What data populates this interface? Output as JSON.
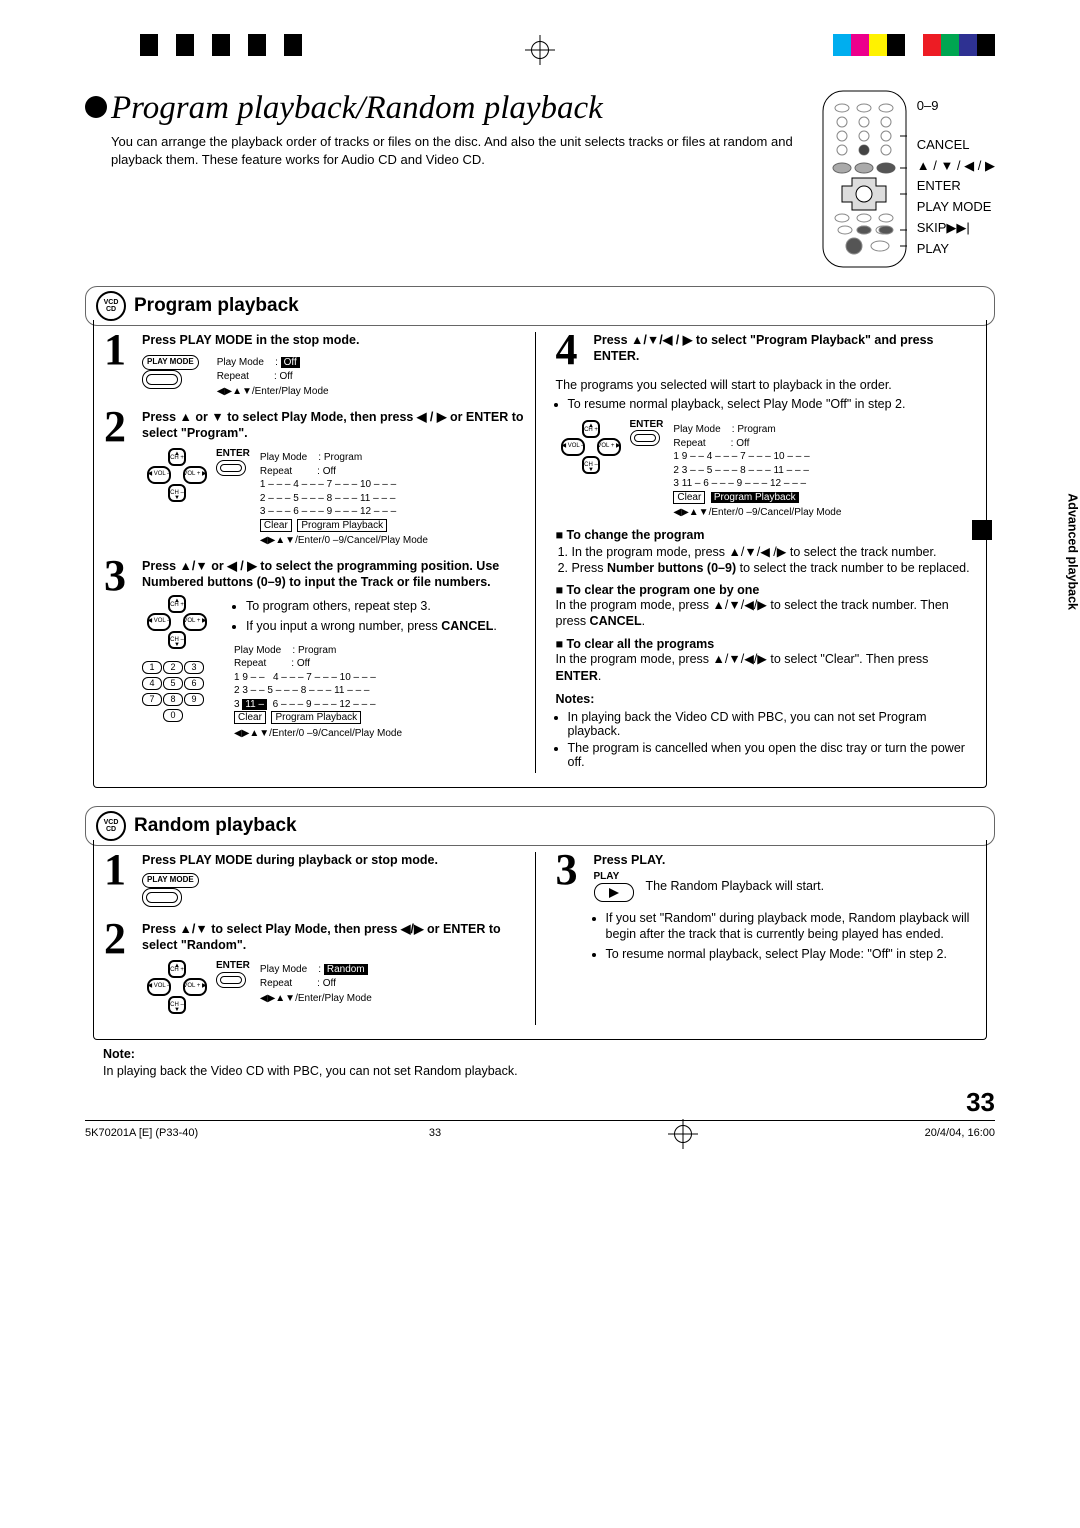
{
  "page": {
    "title": "Program playback/Random playback",
    "intro": "You can arrange the playback order of tracks or files on the disc. And also the unit selects tracks or files at random and playback them. These feature works for Audio CD and Video CD.",
    "number": "33",
    "side_tab": "Advanced playback",
    "footer_left": "5K70201A [E] (P33-40)",
    "footer_center": "33",
    "footer_right": "20/4/04, 16:00"
  },
  "remote_labels": {
    "nums": "0–9",
    "cancel": "CANCEL",
    "arrows": "▲ / ▼ / ◀ / ▶",
    "enter": "ENTER",
    "playmode": "PLAY MODE",
    "skip": "SKIP▶▶|",
    "play": "PLAY"
  },
  "disc_badge": {
    "top": "VCD",
    "bot": "CD"
  },
  "sections": {
    "program": {
      "title": "Program playback",
      "steps": {
        "s1": {
          "num": "1",
          "txt": "Press PLAY MODE in the stop mode.",
          "btn_label": "PLAY MODE"
        },
        "s2": {
          "num": "2",
          "txt": "Press ▲ or ▼ to select Play Mode, then press ◀ / ▶ or ENTER to select \"Program\".",
          "enter": "ENTER"
        },
        "s3": {
          "num": "3",
          "txt": "Press ▲/▼ or ◀ / ▶ to select the programming position. Use Numbered buttons (0–9) to input the Track or file numbers.",
          "bul1": "To program others, repeat step 3.",
          "bul2": "If you input a wrong number, press ",
          "cancel": "CANCEL"
        },
        "s4": {
          "num": "4",
          "txt": "Press ▲/▼/◀ / ▶ to select \"Program Playback\" and press ENTER.",
          "after1": "The programs you selected will start to playback in the order.",
          "bul1": "To resume normal playback, select Play Mode \"Off\" in step 2.",
          "enter": "ENTER"
        }
      },
      "osd1": {
        "l1a": "Play Mode",
        "l1b": ":",
        "l1c": "Off",
        "l2a": "Repeat",
        "l2b": ":",
        "l2c": "Off",
        "footer": "◀▶▲▼/Enter/Play Mode"
      },
      "osd2": {
        "l1a": "Play Mode",
        "l1b": ":",
        "l1c": "Program",
        "l2a": "Repeat",
        "l2b": ":",
        "l2c": "Off",
        "r1": "1  – – –    4  – – –    7  – – –    10  – – –",
        "r2": "2  – – –    5  – – –    8  – – –    11  – – –",
        "r3": "3  – – –    6  – – –    9  – – –    12  – – –",
        "clear": "Clear",
        "pp": "Program Playback",
        "footer": "◀▶▲▼/Enter/0 –9/Cancel/Play Mode"
      },
      "osd3": {
        "l1a": "Play Mode",
        "l1b": ":",
        "l1c": "Program",
        "l2a": "Repeat",
        "l2b": ":",
        "l2c": "Off",
        "r1a": "1",
        "r1a2": "9 – –",
        "r1b": "4  – – –    7  – – –    10  – – –",
        "r2": "2  3 – –    5  – – –    8  – – –    11  – – –",
        "r3a": "3",
        "r3a2": "11 –",
        "r3b": "6  – – –    9  – – –    12  – – –",
        "clear": "Clear",
        "pp": "Program Playback",
        "footer": "◀▶▲▼/Enter/0 –9/Cancel/Play Mode"
      },
      "osd4": {
        "l1a": "Play Mode",
        "l1b": ":",
        "l1c": "Program",
        "l2a": "Repeat",
        "l2b": ":",
        "l2c": "Off",
        "r1": "1  9 – –    4  – – –    7  – – –    10  – – –",
        "r2": "2  3 – –    5  – – –    8  – – –    11  – – –",
        "r3": "3  11 –    6  – – –    9  – – –    12  – – –",
        "clear": "Clear",
        "pp": "Program Playback",
        "footer": "◀▶▲▼/Enter/0 –9/Cancel/Play Mode"
      },
      "right": {
        "h1": "■ To change the program",
        "h1_1": "In the program mode, press ▲/▼/◀ /▶ to select the track number.",
        "h1_2a": "Press ",
        "h1_2b": "Number buttons (0–9)",
        "h1_2c": " to select the track number to be replaced.",
        "h2": "■ To clear the program one by one",
        "h2_1a": "In the program mode, press ▲/▼/◀/▶ to select the track number. Then press ",
        "h2_1b": "CANCEL",
        "h2_1c": ".",
        "h3": "■ To clear all the programs",
        "h3_1a": "In the program mode, press ▲/▼/◀/▶ to select \"Clear\". Then press ",
        "h3_1b": "ENTER",
        "h3_1c": ".",
        "notes_head": "Notes:",
        "note1": "In playing back the Video CD with PBC, you can not set Program playback.",
        "note2": "The program is cancelled when you open the disc tray or turn the power off."
      }
    },
    "random": {
      "title": "Random playback",
      "steps": {
        "s1": {
          "num": "1",
          "txt": "Press PLAY MODE during playback or stop mode.",
          "btn_label": "PLAY MODE"
        },
        "s2": {
          "num": "2",
          "txt": "Press ▲/▼ to select Play Mode, then press ◀/▶ or ENTER to select \"Random\".",
          "enter": "ENTER"
        },
        "s3": {
          "num": "3",
          "txt": "Press PLAY.",
          "btn_label": "PLAY",
          "after1": "The Random Playback will start.",
          "bul1": "If you set \"Random\" during playback mode, Random playback will begin after the track that is currently being played has ended.",
          "bul2": "To resume normal playback, select Play Mode: \"Off\" in step 2."
        }
      },
      "osd": {
        "l1a": "Play Mode",
        "l1b": ":",
        "l1c": "Random",
        "l2a": "Repeat",
        "l2b": ":",
        "l2c": "Off",
        "footer": "◀▶▲▼/Enter/Play Mode"
      },
      "note_head": "Note:",
      "note1": "In playing back the Video CD with PBC, you can not set Random playback."
    }
  }
}
